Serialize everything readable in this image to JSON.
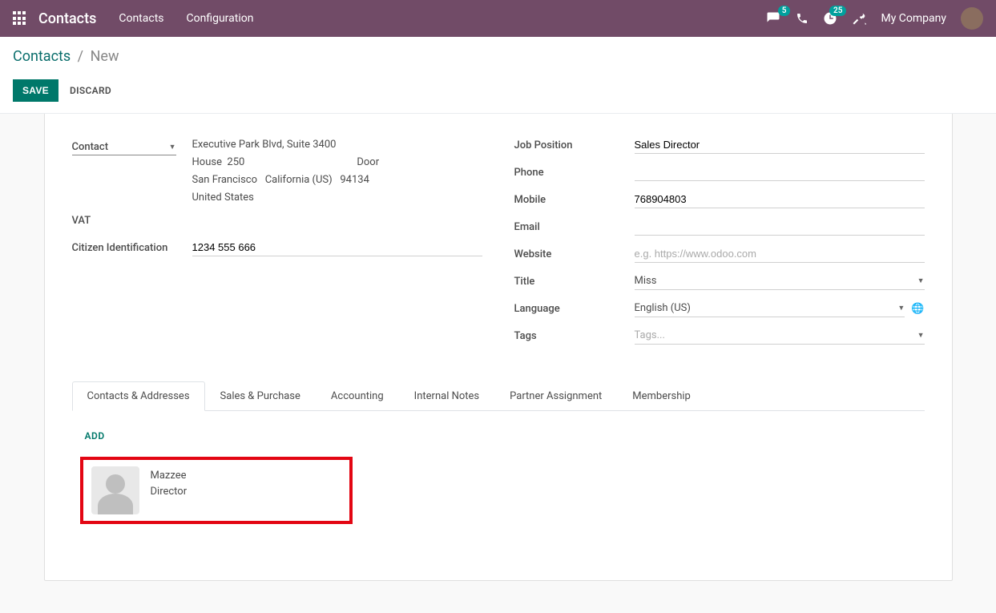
{
  "top": {
    "brand": "Contacts",
    "menu": [
      "Contacts",
      "Configuration"
    ],
    "chat_badge": "5",
    "activity_badge": "25",
    "company": "My Company"
  },
  "breadcrumb": {
    "root": "Contacts",
    "current": "New"
  },
  "actions": {
    "save": "SAVE",
    "discard": "DISCARD"
  },
  "left": {
    "type_select": "Contact",
    "address": {
      "street": "Executive Park Blvd, Suite 3400",
      "house_lbl": "House",
      "house_val": "250",
      "door_lbl": "Door",
      "city": "San Francisco",
      "state": "California (US)",
      "zip": "94134",
      "country": "United States"
    },
    "vat_lbl": "VAT",
    "cid_lbl": "Citizen Identification",
    "cid_val": "1234 555 666"
  },
  "right": {
    "job_lbl": "Job Position",
    "job_val": "Sales Director",
    "phone_lbl": "Phone",
    "phone_val": "",
    "mobile_lbl": "Mobile",
    "mobile_val": "768904803",
    "email_lbl": "Email",
    "email_val": "",
    "website_lbl": "Website",
    "website_ph": "e.g. https://www.odoo.com",
    "title_lbl": "Title",
    "title_val": "Miss",
    "lang_lbl": "Language",
    "lang_val": "English (US)",
    "tags_lbl": "Tags",
    "tags_ph": "Tags..."
  },
  "tabs": [
    "Contacts & Addresses",
    "Sales & Purchase",
    "Accounting",
    "Internal Notes",
    "Partner Assignment",
    "Membership"
  ],
  "tabbody": {
    "add": "ADD",
    "card": {
      "name": "Mazzee",
      "role": "Director"
    }
  }
}
